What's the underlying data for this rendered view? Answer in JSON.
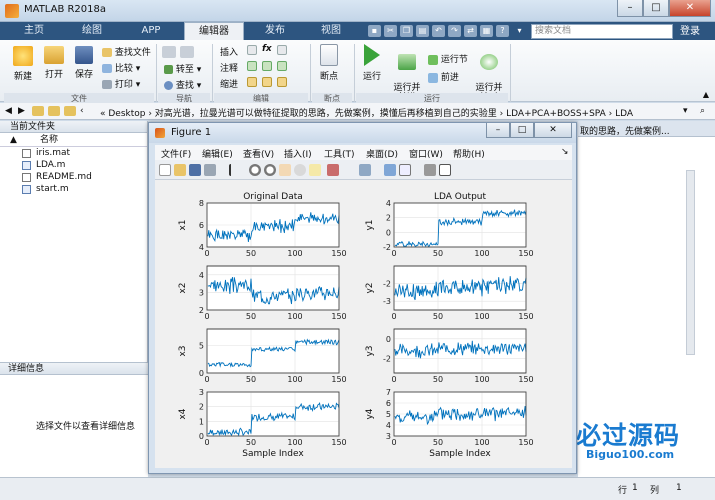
{
  "window": {
    "title": "MATLAB R2018a",
    "min": "–",
    "max": "□",
    "close": "✕"
  },
  "tabs": [
    "主页",
    "绘图",
    "APP",
    "编辑器",
    "发布",
    "视图"
  ],
  "search_placeholder": "搜索文档",
  "login": "登录",
  "ribbon": {
    "file_group": "文件",
    "nav_group": "导航",
    "edit_group": "编辑",
    "break_group": "断点",
    "run_group": "运行",
    "new": "新建",
    "open": "打开",
    "save": "保存",
    "find_files": "查找文件",
    "compare": "比较",
    "print": "打印",
    "goto": "转至",
    "find": "查找",
    "insert": "插入",
    "comment": "注释",
    "indent": "缩进",
    "fx": "fx",
    "breakpoints": "断点",
    "run": "运行",
    "run_advance": "运行并\n前进",
    "run_section": "运行节",
    "advance": "前进",
    "run_time": "运行并\n计时"
  },
  "path": {
    "segments": "« Desktop  ›  对高光谱，拉曼光谱可以做特征提取的思路，先做案例，摸懂后再移植到自己的实验里  ›  LDA+PCA+BOSS+SPA  ›  LDA"
  },
  "current_folder": {
    "title": "当前文件夹",
    "col_name": "名称",
    "sort": "▲",
    "files": [
      {
        "name": "iris.mat",
        "icon": "mat-file-icon"
      },
      {
        "name": "LDA.m",
        "icon": "m-file-icon"
      },
      {
        "name": "README.md",
        "icon": "md-file-icon"
      },
      {
        "name": "start.m",
        "icon": "m-file-icon"
      }
    ]
  },
  "details": {
    "title": "详细信息",
    "message": "选择文件以查看详细信息"
  },
  "right_hint": "取的思路，先做案例...",
  "status": {
    "row_label": "行",
    "row_value": "1",
    "col_label": "列",
    "col_value": "1"
  },
  "watermark": {
    "cn": "必过源码",
    "en": "Biguo100.com"
  },
  "figure": {
    "title": "Figure 1",
    "menu": [
      "文件(F)",
      "编辑(E)",
      "查看(V)",
      "插入(I)",
      "工具(T)",
      "桌面(D)",
      "窗口(W)",
      "帮助(H)"
    ]
  },
  "chart_data": [
    {
      "type": "line",
      "title": "Original Data",
      "ylabel": "x1",
      "xlim": [
        0,
        150
      ],
      "ylim": [
        4,
        8
      ],
      "yticks": [
        4,
        6,
        8
      ],
      "xticks": [
        0,
        50,
        100,
        150
      ],
      "base": [
        5.0,
        5.9,
        6.6
      ],
      "noise": 0.45,
      "seed": 1
    },
    {
      "type": "line",
      "title": "LDA Output",
      "ylabel": "y1",
      "xlim": [
        0,
        150
      ],
      "ylim": [
        -2,
        4
      ],
      "yticks": [
        -2,
        0,
        2,
        4
      ],
      "xticks": [
        0,
        50,
        100,
        150
      ],
      "base": [
        -1.6,
        1.4,
        2.6
      ],
      "noise": 0.35,
      "seed": 2
    },
    {
      "type": "line",
      "title": "",
      "ylabel": "x2",
      "xlim": [
        0,
        150
      ],
      "ylim": [
        2,
        4.5
      ],
      "yticks": [
        2,
        3,
        4
      ],
      "xticks": [
        0,
        50,
        100,
        150
      ],
      "base": [
        3.4,
        2.8,
        3.0
      ],
      "noise": 0.35,
      "seed": 3
    },
    {
      "type": "line",
      "title": "",
      "ylabel": "y2",
      "xlim": [
        0,
        150
      ],
      "ylim": [
        -3.5,
        -1
      ],
      "yticks": [
        -3,
        -2
      ],
      "xticks": [
        0,
        50,
        100,
        150
      ],
      "base": [
        -2.4,
        -2.2,
        -2.1
      ],
      "noise": 0.4,
      "seed": 4
    },
    {
      "type": "line",
      "title": "",
      "ylabel": "x3",
      "xlim": [
        0,
        150
      ],
      "ylim": [
        0,
        8
      ],
      "yticks": [
        0,
        5
      ],
      "xticks": [
        0,
        50,
        100,
        150
      ],
      "base": [
        1.5,
        4.3,
        5.6
      ],
      "noise": 0.35,
      "seed": 5
    },
    {
      "type": "line",
      "title": "",
      "ylabel": "y3",
      "xlim": [
        0,
        150
      ],
      "ylim": [
        -3.5,
        1
      ],
      "yticks": [
        -2,
        0
      ],
      "xticks": [
        0,
        50,
        100,
        150
      ],
      "base": [
        -1.2,
        -1.0,
        -1.0
      ],
      "noise": 0.55,
      "seed": 6
    },
    {
      "type": "line",
      "title": "",
      "ylabel": "x4",
      "xlim": [
        0,
        150
      ],
      "ylim": [
        0,
        3
      ],
      "yticks": [
        0,
        1,
        2,
        3
      ],
      "xticks": [
        0,
        50,
        100,
        150
      ],
      "base": [
        0.25,
        1.3,
        2.0
      ],
      "noise": 0.2,
      "seed": 7,
      "xlabel": "Sample Index"
    },
    {
      "type": "line",
      "title": "",
      "ylabel": "y4",
      "xlim": [
        0,
        150
      ],
      "ylim": [
        3,
        7
      ],
      "yticks": [
        3,
        4,
        5,
        6,
        7
      ],
      "xticks": [
        0,
        50,
        100,
        150
      ],
      "base": [
        4.7,
        5.0,
        5.0
      ],
      "noise": 0.5,
      "seed": 8,
      "xlabel": "Sample Index"
    }
  ]
}
